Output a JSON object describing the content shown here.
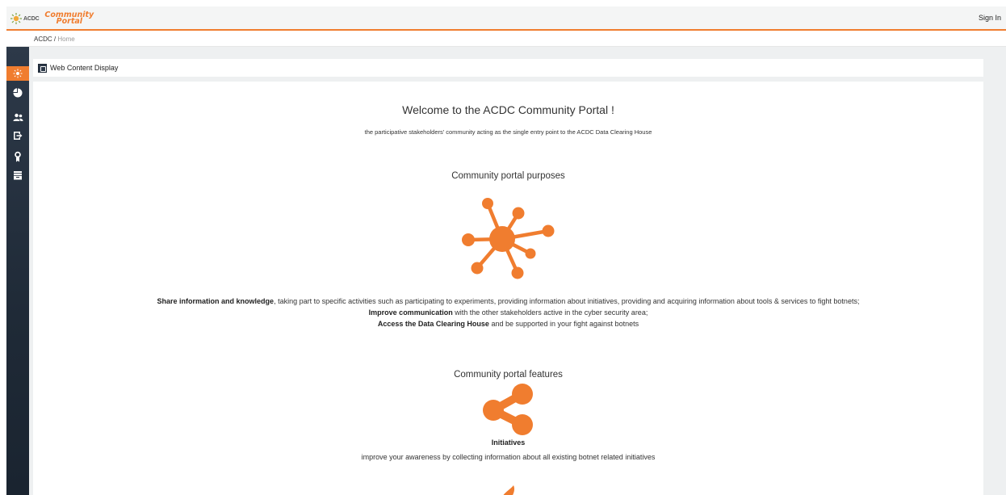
{
  "header": {
    "logo_acdc": "ACDC",
    "logo_line1": "Community",
    "logo_line2": "Portal",
    "signin_label": "Sign In"
  },
  "breadcrumb": {
    "root": "ACDC",
    "separator": " / ",
    "current": "Home"
  },
  "sidebar": {
    "items": [
      {
        "icon": "sun-icon",
        "active": true
      },
      {
        "icon": "pie-chart-icon",
        "active": false
      },
      {
        "icon": "users-icon",
        "active": false
      },
      {
        "icon": "sign-in-icon",
        "active": false
      },
      {
        "icon": "award-icon",
        "active": false
      },
      {
        "icon": "archive-icon",
        "active": false
      }
    ]
  },
  "portlet": {
    "title": "Web Content Display"
  },
  "content": {
    "welcome_title": "Welcome to the ACDC Community Portal !",
    "subtitle": "the participative stakeholders' community acting as the single entry point to the ACDC Data Clearing House",
    "purposes_title": "Community portal purposes",
    "purposes": [
      {
        "bold": "Share information and knowledge",
        "rest": ", taking part to specific activities such as participating to experiments, providing information about initiatives, providing and acquiring information about tools & services to fight botnets;"
      },
      {
        "bold": "Improve communication",
        "rest": " with the other stakeholders active in the cyber security area;"
      },
      {
        "bold": "Access the Data Clearing House",
        "rest": " and be supported in your fight against botnets"
      }
    ],
    "features_title": "Community portal features",
    "feature_name": "Initiatives",
    "feature_desc": "improve your awareness by collecting information about all existing botnet related initiatives"
  },
  "colors": {
    "accent": "#f07d2f",
    "sidebar": "#1f2a37",
    "content_bg": "#eef0f1"
  }
}
